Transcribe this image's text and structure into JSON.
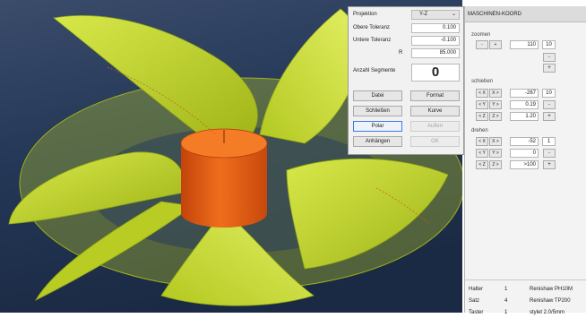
{
  "dialog": {
    "projection_label": "Projektion",
    "projection_value": "Y-Z",
    "upper_tolerance_label": "Obere Toleranz",
    "upper_tolerance_value": "0.100",
    "lower_tolerance_label": "Untere Toleranz",
    "lower_tolerance_value": "-0.100",
    "r_label": "R",
    "r_value": "85.000",
    "segments_label": "Anzahl Segmente",
    "segments_value": "0",
    "buttons": {
      "datei": "Datei",
      "format": "Format",
      "schliessen": "Schließen",
      "kurve": "Kurve",
      "polar": "Polar",
      "auflegen": "Auflen",
      "anhaengen": "Anhängen",
      "ok": "OK"
    }
  },
  "panel": {
    "title": "MASCHINEN-KOORD",
    "zoom": {
      "label": "zoomen",
      "value": "110",
      "step": "10"
    },
    "shift": {
      "label": "schieben",
      "x": {
        "minus": "< X",
        "plus": "X >",
        "value": "-267"
      },
      "y": {
        "minus": "< Y",
        "plus": "Y >",
        "value": "0.19"
      },
      "z": {
        "minus": "< Z",
        "plus": "Z >",
        "value": "1.20"
      },
      "step": "10"
    },
    "rotate": {
      "label": "drehen",
      "x": {
        "minus": "< X",
        "plus": "X >",
        "value": "-52"
      },
      "y": {
        "minus": "< Y",
        "plus": "Y >",
        "value": "0"
      },
      "z": {
        "minus": "< Z",
        "plus": "Z >",
        "value": ">100"
      },
      "step": "1"
    },
    "info": [
      {
        "key": "Halter",
        "num": "1",
        "val": "Renishaw PH10M"
      },
      {
        "key": "Satz",
        "num": "4",
        "val": "Renishaw TP200"
      },
      {
        "key": "Taster",
        "num": "1",
        "val": "stylet 2.0/5mm"
      }
    ]
  },
  "colors": {
    "blade": "#c9dc2a",
    "hub": "#e35d12",
    "viewport_bg": "#1e2d47",
    "accent": "#3b7be0"
  }
}
